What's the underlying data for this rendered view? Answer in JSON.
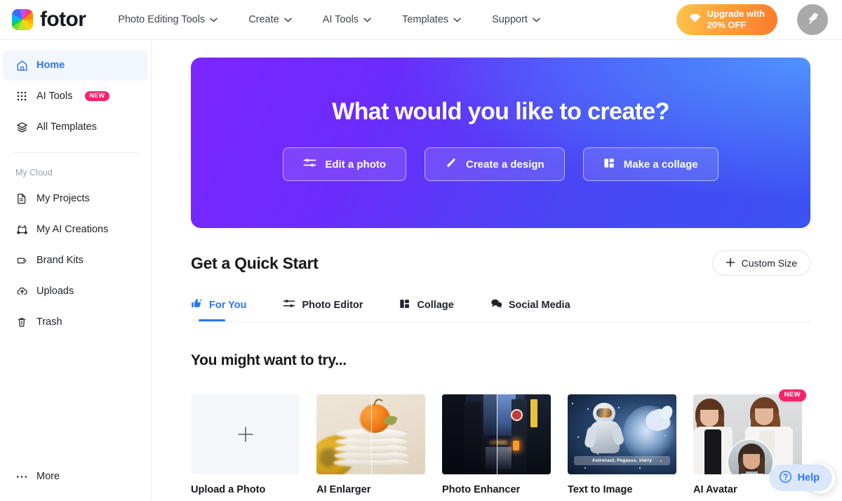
{
  "header": {
    "brand_name": "fotor",
    "brand_logo_icon": "fotor-color-wheel-logo",
    "nav": [
      {
        "label": "Photo Editing Tools",
        "icon": "chevron-down-icon"
      },
      {
        "label": "Create",
        "icon": "chevron-down-icon"
      },
      {
        "label": "AI Tools",
        "icon": "chevron-down-icon"
      },
      {
        "label": "Templates",
        "icon": "chevron-down-icon"
      },
      {
        "label": "Support",
        "icon": "chevron-down-icon"
      }
    ],
    "upgrade": {
      "label": "Upgrade with\n20% OFF",
      "icon": "diamond-icon"
    },
    "avatar": {
      "icon": "bird-avatar-icon"
    }
  },
  "sidebar": {
    "items": [
      {
        "label": "Home",
        "icon": "home-icon",
        "active": true
      },
      {
        "label": "AI Tools",
        "icon": "grid-dots-icon",
        "badge": "NEW"
      },
      {
        "label": "All Templates",
        "icon": "layers-icon"
      }
    ],
    "section_caption": "My Cloud",
    "cloud_items": [
      {
        "label": "My Projects",
        "icon": "document-icon"
      },
      {
        "label": "My AI Creations",
        "icon": "ai-creations-icon"
      },
      {
        "label": "Brand Kits",
        "icon": "tag-icon"
      },
      {
        "label": "Uploads",
        "icon": "cloud-upload-icon"
      },
      {
        "label": "Trash",
        "icon": "trash-icon"
      }
    ],
    "more": {
      "label": "More",
      "icon": "ellipsis-icon"
    }
  },
  "hero": {
    "title": "What would you like to create?",
    "buttons": [
      {
        "label": "Edit a photo",
        "icon": "sliders-icon"
      },
      {
        "label": "Create a design",
        "icon": "magic-wand-icon"
      },
      {
        "label": "Make a collage",
        "icon": "collage-icon"
      }
    ],
    "gradient_from": "#7c26ff",
    "gradient_to": "#3b52f2"
  },
  "quick_start": {
    "title": "Get a Quick Start",
    "custom_size": {
      "label": "Custom Size",
      "icon": "plus-icon"
    },
    "tabs": [
      {
        "label": "For You",
        "icon": "thumbs-up-sparkle-icon",
        "active": true
      },
      {
        "label": "Photo Editor",
        "icon": "sliders-icon",
        "active": false
      },
      {
        "label": "Collage",
        "icon": "collage-icon",
        "active": false
      },
      {
        "label": "Social Media",
        "icon": "chat-bubbles-icon",
        "active": false
      }
    ],
    "accent_color": "#2a77f5"
  },
  "try_section": {
    "title": "You might want to try...",
    "cards": [
      {
        "label": "Upload a Photo",
        "thumb": "upload-placeholder",
        "icon": "plus-icon"
      },
      {
        "label": "AI Enlarger",
        "thumb": "plates-orange-banana-photo"
      },
      {
        "label": "Photo Enhancer",
        "thumb": "night-street-photo"
      },
      {
        "label": "Text to Image",
        "thumb": "astronaut-pegasus-artwork",
        "caption": "Astronaut, Pegasus, starry"
      },
      {
        "label": "AI Avatar",
        "thumb": "two-women-portrait-photo",
        "badge": "NEW"
      }
    ],
    "next_arrow": {
      "icon": "chevron-right-icon"
    }
  },
  "help": {
    "label": "Help",
    "icon": "question-circle-icon",
    "bg_color": "#dbe8fb",
    "text_color": "#2a77f5"
  }
}
